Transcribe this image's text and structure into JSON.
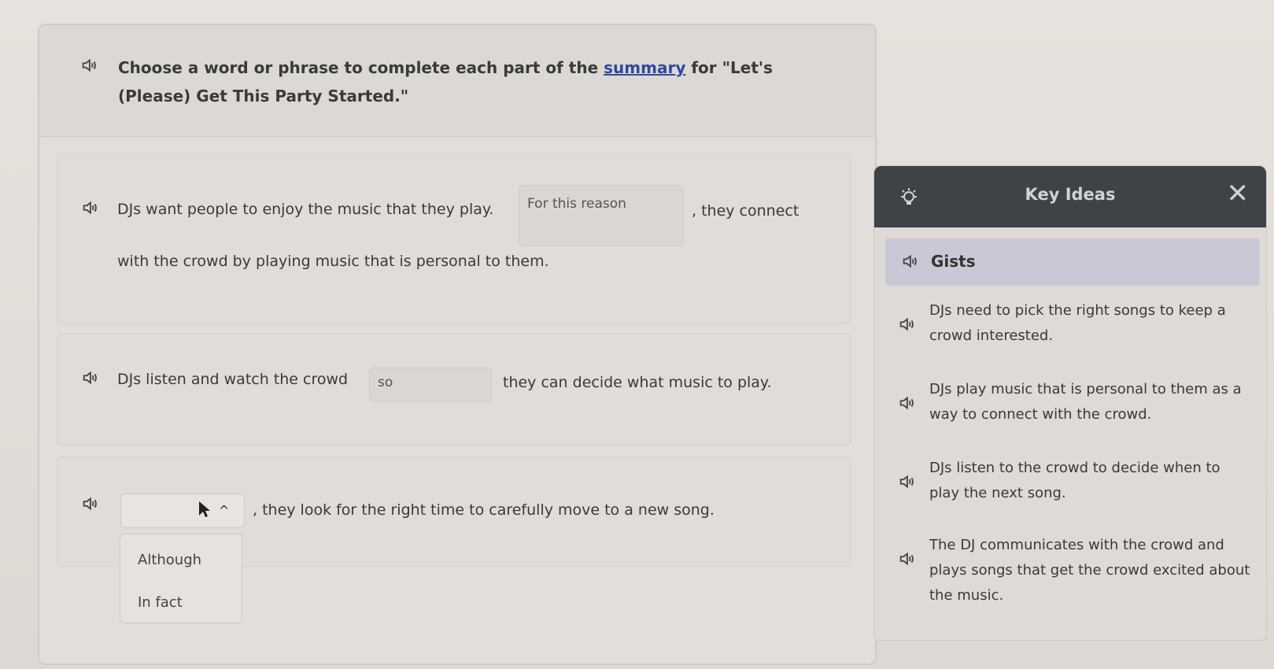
{
  "prompt": {
    "before": "Choose a word or phrase to complete each part of the ",
    "link": "summary",
    "after": " for \"Let's (Please) Get This Party Started.\""
  },
  "questions": [
    {
      "before": "DJs want people to enjoy the music that they play.",
      "selected": "For this reason",
      "after": ", they connect",
      "line2": "with the crowd by playing music that is personal to them."
    },
    {
      "before": "DJs listen and watch the crowd",
      "selected": "so",
      "after": "they can decide what music to play."
    },
    {
      "selected": "",
      "after": ", they look for the right time to carefully move to a new song.",
      "options": [
        "Although",
        "In fact"
      ]
    }
  ],
  "key_ideas": {
    "title": "Key Ideas",
    "close": "✕",
    "section": "Gists",
    "gists": [
      "DJs need to pick the right songs to keep a crowd interested.",
      "DJs play music that is personal to them as a way to connect with the crowd.",
      "DJs listen to the crowd to decide when to play the next song.",
      "The DJ communicates with the crowd and plays songs that get the crowd excited about the music."
    ]
  }
}
